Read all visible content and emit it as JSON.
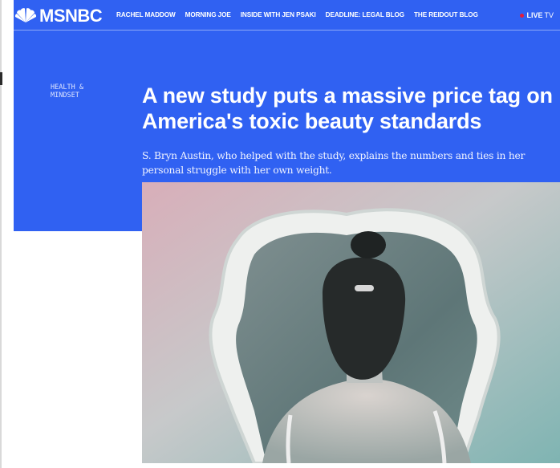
{
  "brand": {
    "name": "MSNBC"
  },
  "nav": {
    "items": [
      "RACHEL MADDOW",
      "MORNING JOE",
      "INSIDE WITH JEN PSAKI",
      "DEADLINE: LEGAL BLOG",
      "THE REIDOUT BLOG"
    ],
    "live_label": "LIVE",
    "live_suffix": "TV"
  },
  "article": {
    "section_line1": "HEALTH &",
    "section_line2": "MINDSET",
    "headline": "A new study puts a massive price tag on America's toxic beauty standards",
    "dek": "S. Bryn Austin, who helped with the study, explains the numbers and ties in her personal struggle with her own weight."
  },
  "colors": {
    "hero_blue": "#3061f2",
    "live_red": "#e51c3c"
  },
  "icons": {
    "logo": "peacock-icon",
    "live": "live-dot-icon"
  }
}
